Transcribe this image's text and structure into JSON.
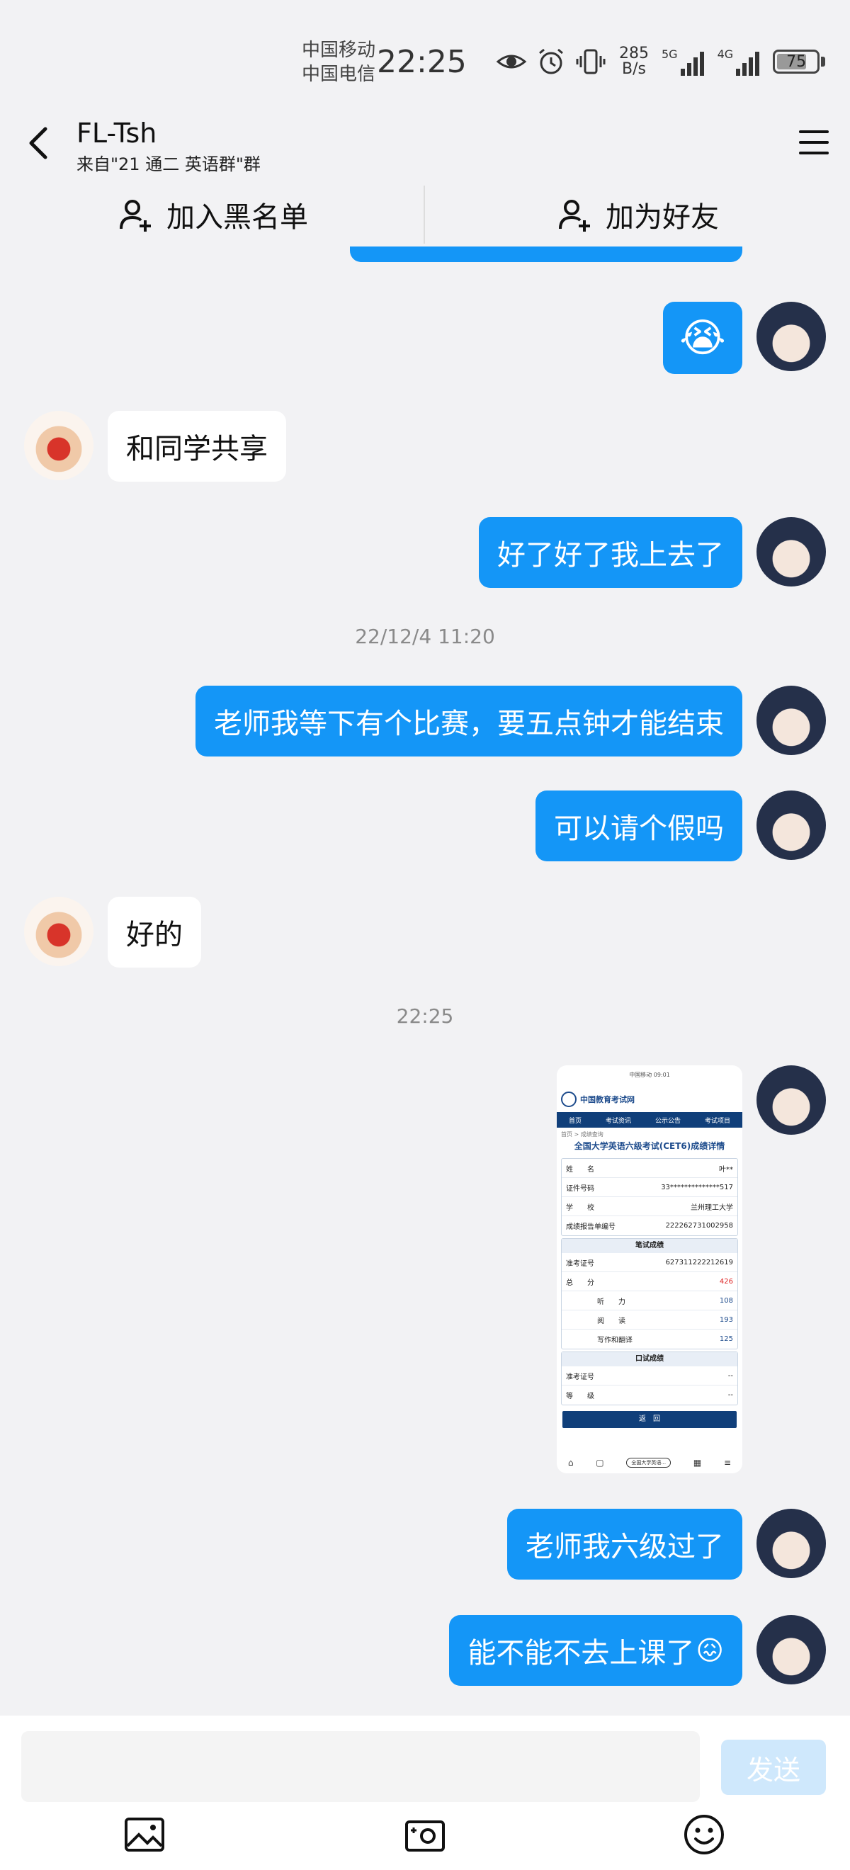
{
  "status_bar": {
    "carrier1": "中国移动",
    "carrier2": "中国电信",
    "time": "22:25",
    "net_speed_value": "285",
    "net_speed_unit": "B/s",
    "sig1_label": "5G",
    "sig2_label": "4G",
    "battery": "75",
    "battery_level": 0.75
  },
  "header": {
    "title": "FL-Tsh",
    "subtitle": "来自\"21 通二 英语群\"群"
  },
  "actions": {
    "blacklist_label": "加入黑名单",
    "add_friend_label": "加为好友"
  },
  "messages": [
    {
      "from": "me",
      "type": "emoji",
      "emoji": "😭"
    },
    {
      "from": "them",
      "text": "和同学共享"
    },
    {
      "from": "me",
      "text": "好了好了我上去了"
    },
    {
      "type": "timestamp",
      "text": "22/12/4 11:20"
    },
    {
      "from": "me",
      "text": "老师我等下有个比赛，要五点钟才能结束"
    },
    {
      "from": "me",
      "text": "可以请个假吗"
    },
    {
      "from": "them",
      "text": "好的"
    },
    {
      "type": "timestamp",
      "text": "22:25"
    },
    {
      "from": "me",
      "type": "image"
    },
    {
      "from": "me",
      "text": "老师我六级过了"
    },
    {
      "from": "me",
      "text": "能不能不去上课了",
      "emoji": "😖"
    }
  ],
  "image": {
    "phone_status": "中国移动 09:01",
    "brand": "中国教育考试网",
    "nav": [
      "首页",
      "考试资讯",
      "公示公告",
      "考试项目"
    ],
    "breadcrumb": "首页 > 成绩查询",
    "heading": "全国大学英语六级考试(CET6)成绩详情",
    "info_rows": [
      {
        "label": "姓　　名",
        "value": "叶**"
      },
      {
        "label": "证件号码",
        "value": "33**************517"
      },
      {
        "label": "学　　校",
        "value": "兰州理工大学"
      },
      {
        "label": "成绩报告单编号",
        "value": "222262731002958"
      }
    ],
    "written_title": "笔试成绩",
    "written_rows": [
      {
        "label": "准考证号",
        "value": "627311222212619"
      },
      {
        "label": "总　　分",
        "value": "426"
      },
      {
        "label": "听　　力",
        "value": "108"
      },
      {
        "label": "阅　　读",
        "value": "193"
      },
      {
        "label": "写作和翻译",
        "value": "125"
      }
    ],
    "oral_title": "口试成绩",
    "oral_rows": [
      {
        "label": "准考证号",
        "value": "--"
      },
      {
        "label": "等　　级",
        "value": "--"
      }
    ],
    "return_label": "返　回",
    "url_label": "全国大学英语..."
  },
  "input_bar": {
    "placeholder": "",
    "send_label": "发送"
  },
  "colors": {
    "outgoing_bubble": "#1496f7",
    "incoming_bubble": "#ffffff",
    "send_disabled": "#cfe8fc"
  }
}
